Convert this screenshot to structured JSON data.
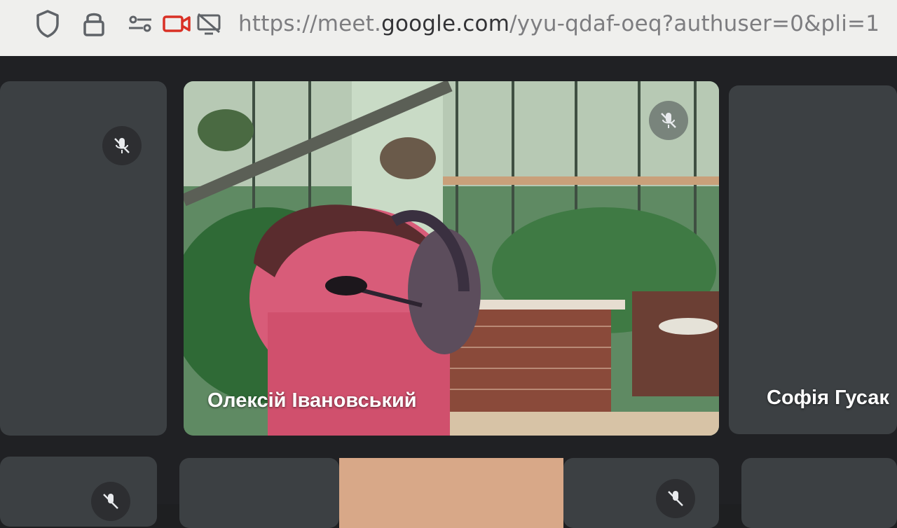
{
  "browser": {
    "url_prefix": "https://meet.",
    "url_host": "google.com",
    "url_path": "/yyu-qdaf-oeq?authuser=0&pli=1",
    "icons": [
      "shield-icon",
      "lock-icon",
      "permissions-icon",
      "camera-icon",
      "screen-share-off-icon"
    ]
  },
  "meet": {
    "participants": [
      {
        "name": "",
        "muted": true
      },
      {
        "name": "Олексій Івановський",
        "muted": true,
        "video": true
      },
      {
        "name": "Софія Гусак",
        "muted": false
      },
      {
        "name": "",
        "muted": true
      },
      {
        "name": "",
        "muted": false
      },
      {
        "name": "",
        "muted": true
      },
      {
        "name": "",
        "muted": false
      }
    ]
  },
  "colors": {
    "tile": "#3c4043",
    "stage": "#202124",
    "camera_active": "#d93025"
  }
}
